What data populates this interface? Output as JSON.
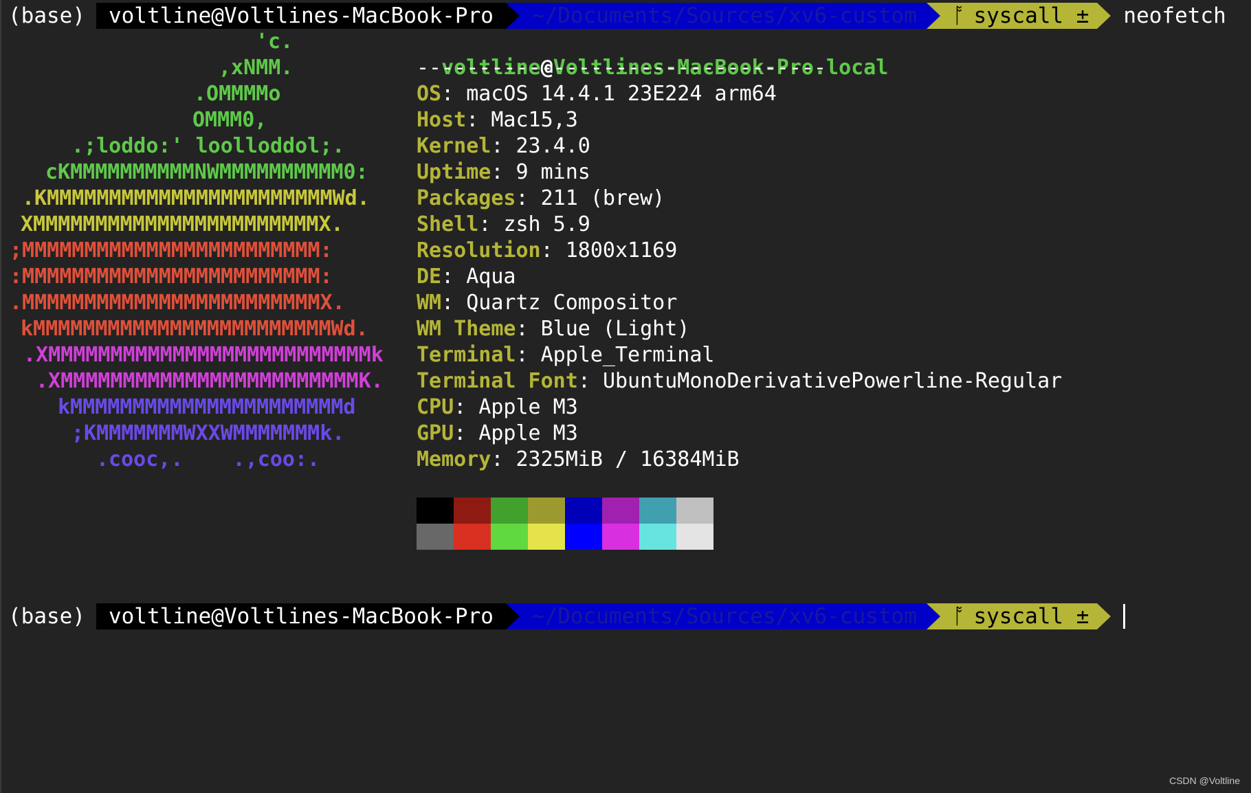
{
  "prompt1": {
    "env": "(base)",
    "user_host": "voltline@Voltlines-MacBook-Pro",
    "dir": "~/Documents/Sources/xv6-custom",
    "branch_icon": "ᚩ",
    "branch": "syscall ±",
    "command": "neofetch"
  },
  "prompt2": {
    "env": "(base)",
    "user_host": "voltline@Voltlines-MacBook-Pro",
    "dir": "~/Documents/Sources/xv6-custom",
    "branch_icon": "ᚩ",
    "branch": "syscall ±"
  },
  "ascii_logo": [
    {
      "text": "'c.",
      "color": "#5fc94a"
    },
    {
      "text": ",xNMM.",
      "color": "#5fc94a"
    },
    {
      "text": ".OMMMMo",
      "color": "#5fc94a"
    },
    {
      "text": "OMMM0,",
      "color": "#5fc94a"
    },
    {
      "text": ".;loddo:' loolloddol;.",
      "color": "#5fc94a"
    },
    {
      "text": "cKMMMMMMMMMMNWMMMMMMMMMM0:",
      "color": "#5fc94a"
    },
    {
      "text": ".KMMMMMMMMMMMMMMMMMMMMMMMWd.",
      "color": "#c8c83c"
    },
    {
      "text": "XMMMMMMMMMMMMMMMMMMMMMMMX.",
      "color": "#c8c83c"
    },
    {
      "text": ";MMMMMMMMMMMMMMMMMMMMMMMM:",
      "color": "#e0503a"
    },
    {
      "text": ":MMMMMMMMMMMMMMMMMMMMMMMM:",
      "color": "#e0503a"
    },
    {
      "text": ".MMMMMMMMMMMMMMMMMMMMMMMMX.",
      "color": "#e0503a"
    },
    {
      "text": "kMMMMMMMMMMMMMMMMMMMMMMMMWd.",
      "color": "#e0503a"
    },
    {
      "text": ".XMMMMMMMMMMMMMMMMMMMMMMMMMMk",
      "color": "#d040d8"
    },
    {
      "text": ".XMMMMMMMMMMMMMMMMMMMMMMMMK.",
      "color": "#d040d8"
    },
    {
      "text": "kMMMMMMMMMMMMMMMMMMMMMMd",
      "color": "#6a4ae8"
    },
    {
      "text": ";KMMMMMMMWXXWMMMMMMMk.",
      "color": "#6a4ae8"
    },
    {
      "text": ".cooc,.    .,coo:.",
      "color": "#6a4ae8"
    }
  ],
  "info": {
    "user": "voltline",
    "at": "@",
    "host": "Voltlines-MacBook-Pro.local",
    "separator": "---------------------------------",
    "rows": [
      {
        "key": "OS",
        "value": "macOS 14.4.1 23E224 arm64"
      },
      {
        "key": "Host",
        "value": "Mac15,3"
      },
      {
        "key": "Kernel",
        "value": "23.4.0"
      },
      {
        "key": "Uptime",
        "value": "9 mins"
      },
      {
        "key": "Packages",
        "value": "211 (brew)"
      },
      {
        "key": "Shell",
        "value": "zsh 5.9"
      },
      {
        "key": "Resolution",
        "value": "1800x1169"
      },
      {
        "key": "DE",
        "value": "Aqua"
      },
      {
        "key": "WM",
        "value": "Quartz Compositor"
      },
      {
        "key": "WM Theme",
        "value": "Blue (Light)"
      },
      {
        "key": "Terminal",
        "value": "Apple_Terminal"
      },
      {
        "key": "Terminal Font",
        "value": "UbuntuMonoDerivativePowerline-Regular"
      },
      {
        "key": "CPU",
        "value": "Apple M3"
      },
      {
        "key": "GPU",
        "value": "Apple M3"
      },
      {
        "key": "Memory",
        "value": "2325MiB / 16384MiB"
      }
    ],
    "colon": ": "
  },
  "palette": {
    "normal": [
      "#000000",
      "#8e1a12",
      "#42a02c",
      "#9c9a2e",
      "#0000b8",
      "#a020b0",
      "#40a0b0",
      "#c0c0c0"
    ],
    "bright": [
      "#686868",
      "#d83020",
      "#60d840",
      "#e4e44a",
      "#0000ff",
      "#d830e0",
      "#68e4e0",
      "#e4e4e4"
    ]
  },
  "watermark": "CSDN @Voltline"
}
